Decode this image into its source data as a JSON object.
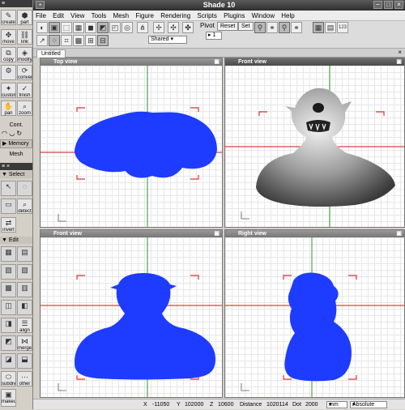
{
  "window": {
    "title": "Shade 10"
  },
  "menu": [
    "File",
    "Edit",
    "View",
    "Tools",
    "Mesh",
    "Figure",
    "Rendering",
    "Scripts",
    "Plugins",
    "Window",
    "Help"
  ],
  "toolbar": {
    "pivot": "Pivot",
    "reset": "Reset",
    "set": "Set",
    "pivot_value": "1",
    "shared_value": "Shared",
    "num_badge": "123"
  },
  "document": {
    "tab": "Untitled"
  },
  "tools": {
    "create": "create",
    "part": "part",
    "move": "move",
    "link": "link",
    "copy": "copy",
    "modify": "modify",
    "convert": "convert",
    "custom": "custom",
    "finish": "finish",
    "pan": "pan",
    "zoom": "zoom",
    "cont": "Cont.",
    "memory": "Memory",
    "mesh": "Mesh"
  },
  "edit_panel": {
    "select": "Select",
    "edit": "Edit",
    "detect": "detect",
    "invert": "invert",
    "align": "align",
    "merge": "merge",
    "subdiv": "subdiv",
    "other": "other",
    "makeu": "makeu"
  },
  "viewports": [
    {
      "name": "Top view",
      "active": false
    },
    {
      "name": "Front view",
      "active": true
    },
    {
      "name": "Front view",
      "active": false
    },
    {
      "name": "Right view",
      "active": false
    }
  ],
  "status": {
    "x_label": "X",
    "x_value": "-11050",
    "y_label": "Y",
    "y_value": "102000",
    "z_label": "Z",
    "z_value": "10600",
    "distance_label": "Distance",
    "distance_value": "1020114",
    "dot_label": "Dot",
    "dot_value": "2000",
    "unit": "mm",
    "mode": "Absolute"
  },
  "colors": {
    "mesh": "#1e3cff",
    "crop": "#e03030",
    "axis_h": "#d01010",
    "axis_v": "#2a9a2a"
  }
}
